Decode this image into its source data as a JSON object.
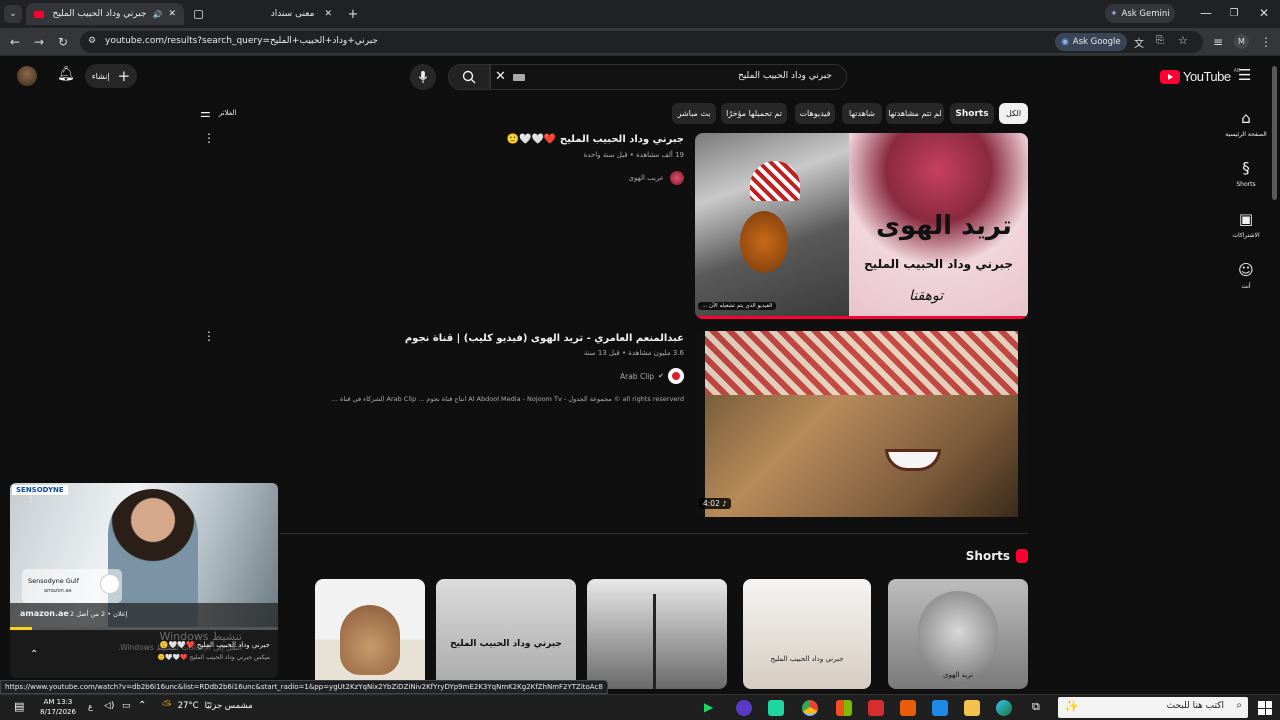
{
  "browser": {
    "tabs": [
      {
        "title": "جبرني وداد الحبيب المليح - Yo",
        "active": true
      },
      {
        "title": "معنى سنداد",
        "active": false
      }
    ],
    "new_tab": "+",
    "ask_gemini": "Ask Gemini",
    "url": "youtube.com/results?search_query=جبرني+وداد+الحبيب+المليح",
    "ask_google": "Ask Google",
    "profile": "M"
  },
  "youtube": {
    "logo": "YouTube",
    "region": "AE",
    "search_value": "جبرني وداد الحبيب المليح",
    "create_label": "إنشاء",
    "filters_label": "الفلاتر",
    "chips": [
      "الكل",
      "Shorts",
      "لم تتم مشاهدتها",
      "شاهدتها",
      "فيديوهات",
      "تم تحميلها مؤخرًا",
      "بث مباشر"
    ],
    "sidebar": [
      {
        "label": "الصفحة الرئيسية",
        "icon": "home-icon"
      },
      {
        "label": "Shorts",
        "icon": "shorts-icon"
      },
      {
        "label": "الاشتراكات",
        "icon": "subscriptions-icon"
      },
      {
        "label": "أنت",
        "icon": "you-icon"
      }
    ],
    "results": [
      {
        "title": "جبرني وداد الحبيب المليح ❤️🤍🤍🙂",
        "meta": "19 ألف مشاهدة • قبل سنة واحدة",
        "channel": "عريب الهوى",
        "thumb_title": "تريد الهوى",
        "thumb_sub": "جبرني وداد الحبيب المليح",
        "thumb_sign": "توهقنا",
        "overlay": "الفيديو الذي يتم تشغيله الآن ..."
      },
      {
        "title": "عبدالمنعم العامري - تريد الهوى (فيديو كليب) | قناة نجوم",
        "meta": "3.6 مليون مشاهدة • قبل 13 سنة",
        "channel": "Arab Clip",
        "description": "all rights reserverd © مجموعة الجدول - Al Abdool Media - Nojoom Tv انتاج قناة نجوم ... Arab Clip الشركاء في قناة ...",
        "duration": "4:02"
      }
    ],
    "shorts_heading": "Shorts",
    "short_captions": [
      "",
      "جبرني وداد الحبيب المليح",
      "",
      "جبرني وداد الحبيب المليح",
      "تريد الهوى"
    ]
  },
  "ad": {
    "brand": "SENSODYNE",
    "advertiser": "Sensodyne Gulf",
    "domain": "amazon.ae",
    "cta": "amazon.ae",
    "counter": "إعلان • 2 من أصل 2",
    "np_title": "جبرني وداد الحبيب المليح ❤️🤍🤍🙂",
    "np_sub": "ميكس جبرني وداد الحبيب المليح ❤️🤍🤍🙂"
  },
  "watermark": {
    "line1": "تنشيط Windows",
    "line2": "انتقل إلى الإعدادات لتنشيط Windows."
  },
  "status_url": "https://www.youtube.com/watch?v=db2b6i16unc&list=RDdb2b6i16unc&start_radio=1&pp=ygUt2KzYqNix2YbZiDZiNiv2KfYryDYp9mE2K3YqNmK2Kg2KfZhNmF2YTZitoAc8",
  "taskbar": {
    "search_placeholder": "اكتب هنا للبحث",
    "weather_temp": "27°C",
    "weather_desc": "مشمس جزئيًا",
    "time": "AM 13:3",
    "date": "8/17/2026",
    "lang": "ع"
  }
}
